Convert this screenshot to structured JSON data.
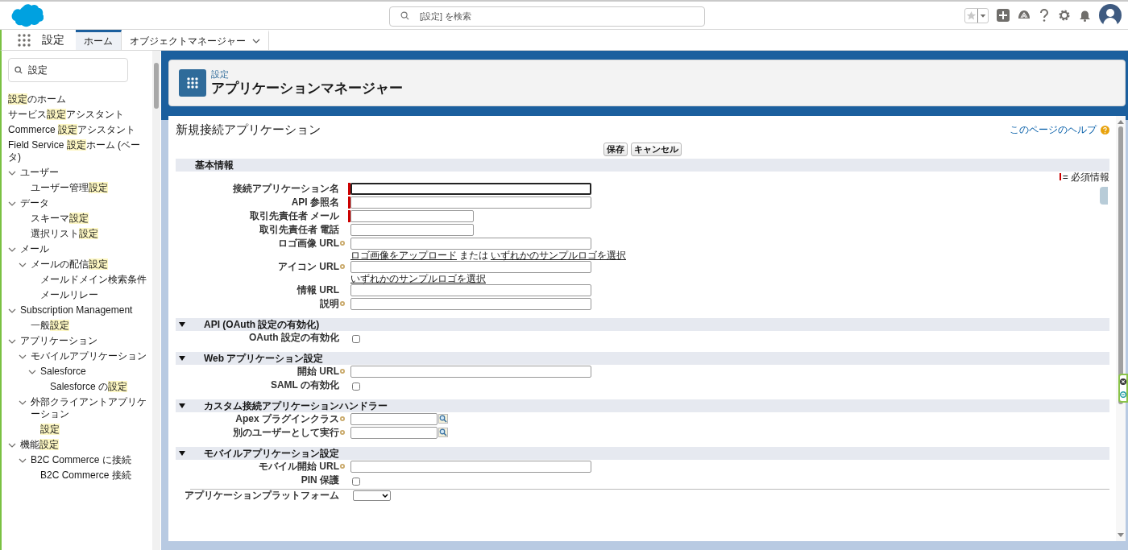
{
  "header": {
    "search_placeholder": "[設定] を検索"
  },
  "nav": {
    "app_name": "設定",
    "tabs": [
      {
        "label": "ホーム",
        "selected": true,
        "menu": false
      },
      {
        "label": "オブジェクトマネージャー",
        "selected": false,
        "menu": true
      }
    ]
  },
  "sidebar": {
    "search": {
      "value": "設定"
    },
    "items": [
      {
        "label": "**設定**のホーム"
      },
      {
        "label": "サービス**設定**アシスタント"
      },
      {
        "label": "Commerce **設定**アシスタント"
      },
      {
        "label": "Field Service **設定**ホーム (ベータ)"
      },
      {
        "label": "ユーザー",
        "expanded": true,
        "children": [
          {
            "label": "ユーザー管理**設定**"
          }
        ]
      },
      {
        "label": "データ",
        "expanded": true,
        "children": [
          {
            "label": "スキーマ**設定**"
          },
          {
            "label": "選択リスト**設定**"
          }
        ]
      },
      {
        "label": "メール",
        "expanded": true,
        "children": [
          {
            "label": "メールの配信**設定**",
            "expanded": true,
            "children": [
              {
                "label": "メールドメイン検索条件"
              },
              {
                "label": "メールリレー"
              }
            ]
          }
        ]
      },
      {
        "label": "Subscription Management",
        "expanded": true,
        "children": [
          {
            "label": "一般**設定**"
          }
        ]
      },
      {
        "label": "アプリケーション",
        "expanded": true,
        "children": [
          {
            "label": "モバイルアプリケーション",
            "expanded": true,
            "children": [
              {
                "label": "Salesforce",
                "expanded": true,
                "children": [
                  {
                    "label": "Salesforce の**設定**"
                  }
                ]
              }
            ]
          },
          {
            "label": "外部クライアントアプリケーション",
            "expanded": true,
            "children": [
              {
                "label": "**設定**"
              }
            ]
          }
        ]
      },
      {
        "label": "機能**設定**",
        "expanded": true,
        "children": [
          {
            "label": "B2C Commerce に接続",
            "expanded": true,
            "children": [
              {
                "label": "B2C Commerce 接続"
              }
            ]
          }
        ]
      }
    ]
  },
  "page_header": {
    "breadcrumb": "設定",
    "title": "アプリケーションマネージャー"
  },
  "form": {
    "title": "新規接続アプリケーション",
    "help_link": "このページのヘルプ",
    "buttons": [
      "保存",
      "キャンセル"
    ],
    "required_legend": "= 必須情報",
    "sections": [
      {
        "title": "基本情報",
        "collapsible": false,
        "expanded": true,
        "fields": [
          {
            "label": "接続アプリケーション名",
            "kind": "text",
            "required": true,
            "help": false,
            "focused": true
          },
          {
            "label": "API 参照名",
            "kind": "text",
            "required": true,
            "help": false,
            "focused": false
          },
          {
            "label": "取引先責任者 メール",
            "kind": "short_text",
            "required": true,
            "help": false,
            "focused": false
          },
          {
            "label": "取引先責任者 電話",
            "kind": "short_text",
            "required": false,
            "help": false,
            "focused": false
          },
          {
            "label": "ロゴ画像 URL",
            "kind": "text",
            "required": false,
            "help": true,
            "focused": false,
            "hint": [
              {
                "text": "ロゴ画像をアップロード",
                "link": true
              },
              {
                "text": "または",
                "link": false
              },
              {
                "text": "いずれかのサンプルロゴを選択",
                "link": true
              }
            ]
          },
          {
            "label": "アイコン URL",
            "kind": "text",
            "required": false,
            "help": true,
            "focused": false,
            "hint": [
              {
                "text": "いずれかのサンプルロゴを選択",
                "link": true
              }
            ]
          },
          {
            "label": "情報 URL",
            "kind": "text",
            "required": false,
            "help": false,
            "focused": false
          },
          {
            "label": "説明",
            "kind": "text",
            "required": false,
            "help": true,
            "focused": false
          }
        ]
      },
      {
        "title": "API (OAuth 設定の有効化)",
        "collapsible": true,
        "expanded": true,
        "fields": [
          {
            "label": "OAuth 設定の有効化",
            "kind": "checkbox",
            "required": false,
            "help": false,
            "checked": false
          }
        ]
      },
      {
        "title": "Web アプリケーション設定",
        "collapsible": true,
        "expanded": true,
        "fields": [
          {
            "label": "開始 URL",
            "kind": "text",
            "required": false,
            "help": true,
            "focused": false
          },
          {
            "label": "SAML の有効化",
            "kind": "checkbox",
            "required": false,
            "help": false,
            "checked": false
          }
        ]
      },
      {
        "title": "カスタム接続アプリケーションハンドラー",
        "collapsible": true,
        "expanded": true,
        "fields": [
          {
            "label": "Apex プラグインクラス",
            "kind": "lookup",
            "required": false,
            "help": true,
            "focused": false
          },
          {
            "label": "別のユーザーとして実行",
            "kind": "lookup",
            "required": false,
            "help": true,
            "focused": false
          }
        ]
      },
      {
        "title": "モバイルアプリケーション設定",
        "collapsible": true,
        "expanded": true,
        "fields": [
          {
            "label": "モバイル開始 URL",
            "kind": "text",
            "required": false,
            "help": true,
            "focused": false
          },
          {
            "label": "PIN 保護",
            "kind": "checkbox",
            "required": false,
            "help": false,
            "checked": false
          },
          {
            "label": "アプリケーションプラットフォーム",
            "kind": "select",
            "required": false,
            "help": false,
            "divider": true
          }
        ]
      }
    ]
  }
}
